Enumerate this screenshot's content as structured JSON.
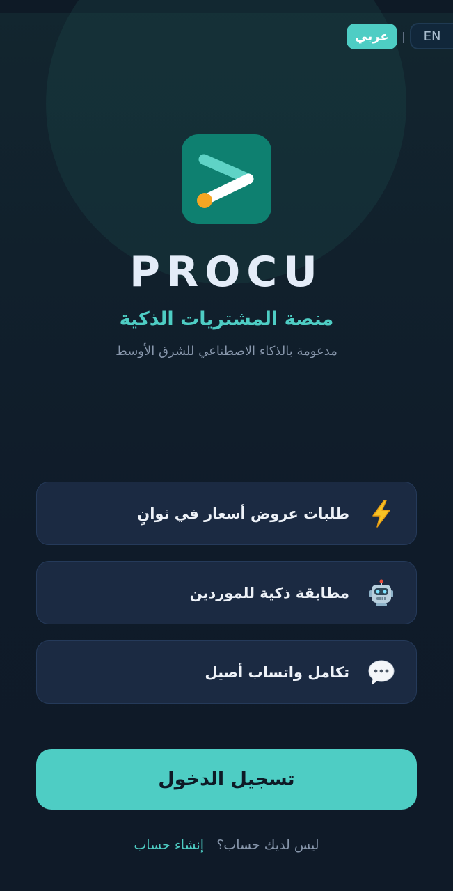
{
  "language_toggle": {
    "arabic_label": "عربي",
    "separator": "|",
    "english_label": "EN"
  },
  "brand": {
    "logo_icon": "procu-logo-icon",
    "name": "PROCU",
    "subtitle": "منصة المشتريات الذكية",
    "tagline": "مدعومة بالذكاء الاصطناعي للشرق الأوسط"
  },
  "features": [
    {
      "icon": "lightning-icon",
      "label": "طلبات عروض أسعار في ثوانٍ"
    },
    {
      "icon": "robot-icon",
      "label": "مطابقة ذكية للموردين"
    },
    {
      "icon": "speech-bubble-icon",
      "label": "تكامل واتساب أصيل"
    }
  ],
  "actions": {
    "login_label": "تسجيل الدخول",
    "signup_question": "ليس لديك حساب؟",
    "signup_link": "إنشاء حساب"
  },
  "colors": {
    "accent": "#4ecdc4",
    "logo_background": "#0e8070",
    "logo_dot": "#f5a623",
    "background": "#0f1b2a",
    "card_background": "#1b2a42"
  }
}
